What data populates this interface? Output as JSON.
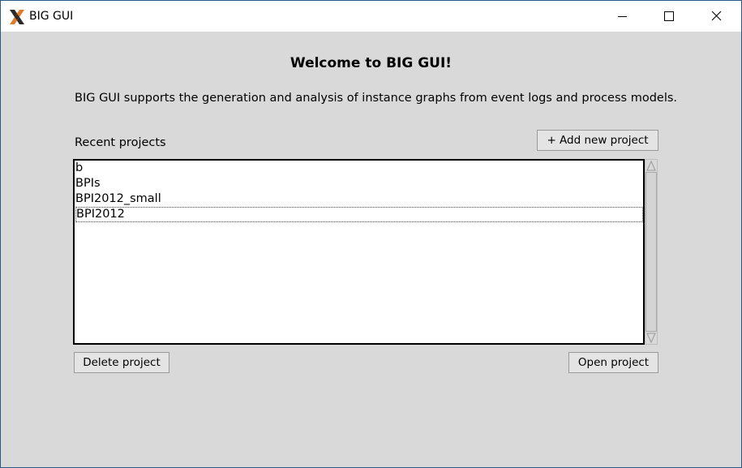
{
  "window": {
    "title": "BIG GUI",
    "controls": [
      "minimize-icon",
      "maximize-icon",
      "close-icon"
    ]
  },
  "main": {
    "heading": "Welcome to BIG GUI!",
    "description": "BIG GUI supports the generation and analysis of instance graphs from event logs and process models.",
    "recent_label": "Recent projects",
    "add_button": "+ Add new project",
    "delete_button": "Delete project",
    "open_button": "Open project",
    "projects": [
      "b",
      "BPIs",
      "BPI2012_small",
      "BPI2012"
    ],
    "selected_project": "BPI2012"
  }
}
